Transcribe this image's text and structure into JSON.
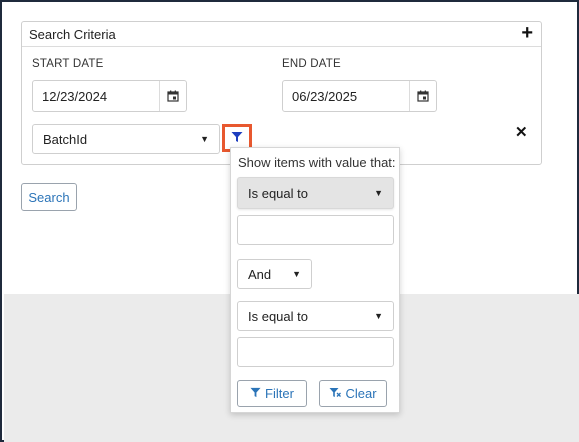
{
  "panel": {
    "title": "Search Criteria",
    "add_icon": "plus-icon"
  },
  "start_date": {
    "label": "START DATE",
    "value": "12/23/2024",
    "icon": "calendar-icon"
  },
  "end_date": {
    "label": "END DATE",
    "value": "06/23/2025",
    "icon": "calendar-icon"
  },
  "field_select": {
    "value": "BatchId"
  },
  "filter_icon": "filter-icon",
  "remove_icon": "close-icon",
  "search_button": {
    "label": "Search"
  },
  "filter_popup": {
    "title": "Show items with value that:",
    "operator1": "Is equal to",
    "value1": "",
    "logic": "And",
    "operator2": "Is equal to",
    "value2": "",
    "filter_label": "Filter",
    "clear_label": "Clear"
  },
  "colors": {
    "accent": "#2b74b8",
    "highlight_border": "#e8582f",
    "filter_icon": "#1f3fbf"
  }
}
